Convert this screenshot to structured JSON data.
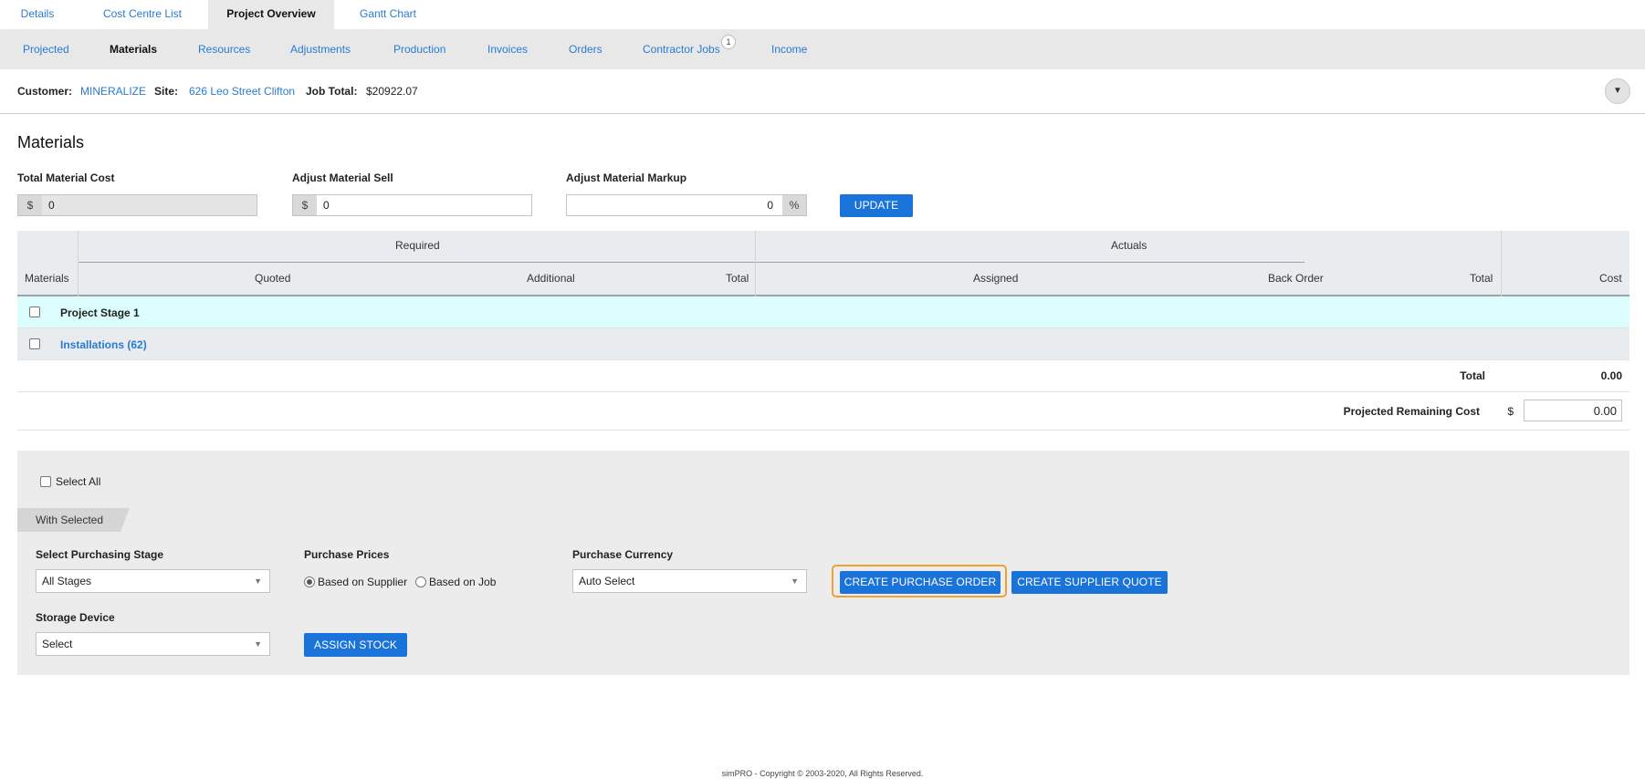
{
  "top_tabs": [
    "Details",
    "Cost Centre List",
    "Project Overview",
    "Gantt Chart"
  ],
  "sub_tabs": [
    "Projected",
    "Materials",
    "Resources",
    "Adjustments",
    "Production",
    "Invoices",
    "Orders",
    "Contractor Jobs",
    "Income"
  ],
  "contractor_jobs_badge": "1",
  "info": {
    "customer_label": "Customer:",
    "customer_value": "MINERALIZE",
    "site_label": "Site:",
    "site_value": "626 Leo Street Clifton",
    "job_total_label": "Job Total:",
    "job_total_value": "$20922.07"
  },
  "materials": {
    "title": "Materials",
    "total_cost_label": "Total Material Cost",
    "total_cost_currency": "$",
    "total_cost_value": "0",
    "adjust_sell_label": "Adjust Material Sell",
    "adjust_sell_currency": "$",
    "adjust_sell_value": "0",
    "adjust_markup_label": "Adjust Material Markup",
    "adjust_markup_value": "0",
    "adjust_markup_unit": "%",
    "update_button": "UPDATE"
  },
  "table": {
    "group_required": "Required",
    "group_actuals": "Actuals",
    "col_materials": "Materials",
    "col_quoted": "Quoted",
    "col_additional": "Additional",
    "col_total_req": "Total",
    "col_assigned": "Assigned",
    "col_back_order": "Back Order",
    "col_total_act": "Total",
    "col_cost": "Cost",
    "stage_row": "Project Stage 1",
    "installations_row": "Installations (62)",
    "total_label": "Total",
    "total_value": "0.00",
    "projected_remaining_label": "Projected Remaining Cost",
    "projected_remaining_currency": "$",
    "projected_remaining_value": "0.00"
  },
  "panel": {
    "select_all": "Select All",
    "with_selected": "With Selected",
    "purchasing_stage_label": "Select Purchasing Stage",
    "purchasing_stage_value": "All Stages",
    "purchase_prices_label": "Purchase Prices",
    "based_on_supplier": "Based on Supplier",
    "based_on_job": "Based on Job",
    "purchase_currency_label": "Purchase Currency",
    "purchase_currency_value": "Auto Select",
    "create_po_button": "CREATE PURCHASE ORDER",
    "create_sq_button": "CREATE SUPPLIER QUOTE",
    "storage_device_label": "Storage Device",
    "storage_device_value": "Select",
    "assign_stock_button": "ASSIGN STOCK"
  },
  "footer": "simPRO - Copyright © 2003-2020, All Rights Reserved.",
  "colors": {
    "accent": "#1a73d9",
    "link": "#2a7ad3",
    "highlight_row": "#dcfdfd",
    "focus_outline": "#f0a030"
  }
}
